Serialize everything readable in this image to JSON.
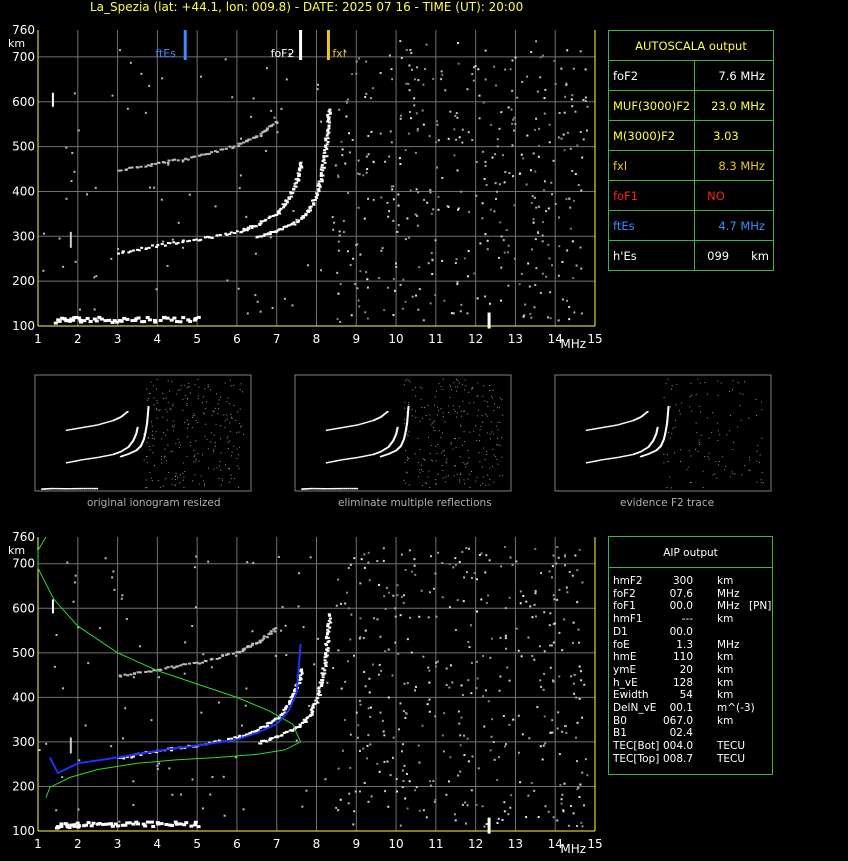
{
  "header": {
    "title": "La_Spezia (lat: +44.1, lon: 009.8) - DATE: 2025 07 16 - TIME (UT): 20:00"
  },
  "colors": {
    "axis": "#ffff40",
    "grid": "#707070",
    "border": "#3cb54a",
    "ftes": "#3c8cff",
    "fxl": "#e6c81e",
    "fof1": "#ff2020",
    "profile": "#30d830",
    "trace": "#2030ff"
  },
  "axes": {
    "x_ticks": [
      "1",
      "2",
      "3",
      "4",
      "5",
      "6",
      "7",
      "8",
      "9",
      "10",
      "11",
      "12",
      "13",
      "14",
      "15"
    ],
    "y_ticks": [
      "100",
      "200",
      "300",
      "400",
      "500",
      "600",
      "700",
      "760"
    ],
    "x_unit": "MHz",
    "y_unit": "km"
  },
  "markers": {
    "ftes_label": "ftEs",
    "fof2_label": "foF2",
    "fxl_label": "fxl"
  },
  "autoscala": {
    "title": "AUTOSCALA output",
    "rows": [
      {
        "label": "foF2",
        "value": "7.6 MHz"
      },
      {
        "label": "MUF(3000)F2",
        "value": "23.0 MHz"
      },
      {
        "label": "M(3000)F2",
        "value": "3.03"
      },
      {
        "label": "fxl",
        "value": "8.3 MHz"
      },
      {
        "label": "foF1",
        "value": "NO"
      },
      {
        "label": "ftEs",
        "value": "4.7 MHz"
      },
      {
        "label": "h'Es",
        "value": "099",
        "unit": "km"
      }
    ]
  },
  "thumbnails": {
    "captions": [
      "original ionogram resized",
      "eliminate multiple reflections",
      "evidence F2 trace"
    ]
  },
  "aip": {
    "title": "AIP output",
    "rows": [
      [
        "hmF2",
        "300",
        "km",
        ""
      ],
      [
        "foF2",
        "07.6",
        "MHz",
        ""
      ],
      [
        "foF1",
        "00.0",
        "MHz",
        "[PN]"
      ],
      [
        "hmF1",
        "---",
        "km",
        ""
      ],
      [
        "D1",
        "00.0",
        "",
        ""
      ],
      [
        "foE",
        "1.3",
        "MHz",
        ""
      ],
      [
        "hmE",
        "110",
        "km",
        ""
      ],
      [
        "ymE",
        "20",
        "km",
        ""
      ],
      [
        "h_vE",
        "128",
        "km",
        ""
      ],
      [
        "Ewidth",
        "54",
        "km",
        ""
      ],
      [
        "DelN_vE",
        "00.1",
        "m^(-3)",
        ""
      ],
      [
        "B0",
        "067.0",
        "km",
        ""
      ],
      [
        "B1",
        "02.4",
        "",
        ""
      ],
      [
        "TEC[Bot]",
        "004.0",
        "TECU",
        ""
      ],
      [
        "TEC[Top]",
        "008.7",
        "TECU",
        ""
      ]
    ]
  },
  "chart_data": [
    {
      "type": "scatter",
      "title": "",
      "xlabel": "MHz",
      "ylabel": "km",
      "xlim": [
        1,
        15
      ],
      "ylim": [
        100,
        760
      ],
      "grid": true,
      "markers": [
        {
          "name": "ftEs",
          "x": 4.7
        },
        {
          "name": "foF2",
          "x": 7.6
        },
        {
          "name": "fxl",
          "x": 8.3
        }
      ],
      "traces": [
        {
          "name": "E layer echo",
          "x": [
            1.4,
            2.0,
            3.0,
            4.0,
            5.1
          ],
          "y": [
            115,
            118,
            117,
            118,
            118
          ]
        },
        {
          "name": "F2 O-mode",
          "x": [
            3.0,
            4.0,
            5.0,
            6.0,
            6.5,
            7.0,
            7.3,
            7.5,
            7.6
          ],
          "y": [
            265,
            282,
            295,
            312,
            328,
            355,
            390,
            430,
            470
          ]
        },
        {
          "name": "F2 X-mode",
          "x": [
            6.5,
            7.0,
            7.5,
            7.8,
            8.0,
            8.1,
            8.2,
            8.25,
            8.3
          ],
          "y": [
            300,
            315,
            335,
            360,
            400,
            440,
            490,
            540,
            590
          ]
        },
        {
          "name": "F2 second hop",
          "x": [
            3.0,
            4.0,
            5.0,
            6.0,
            6.5,
            7.0
          ],
          "y": [
            450,
            465,
            480,
            505,
            525,
            560
          ]
        }
      ]
    },
    {
      "type": "line",
      "title": "",
      "xlabel": "MHz",
      "ylabel": "km",
      "xlim": [
        1,
        15
      ],
      "ylim": [
        100,
        760
      ],
      "grid": true,
      "series": [
        {
          "name": "profile",
          "x": [
            1.2,
            1.0,
            1.0,
            1.4,
            2.0,
            3.0,
            4.0,
            5.0,
            6.0,
            6.8,
            7.4,
            7.6,
            7.2,
            6.5,
            5.5,
            4.5,
            3.5,
            2.5,
            1.8,
            1.3,
            1.2
          ],
          "y": [
            760,
            730,
            690,
            620,
            560,
            500,
            460,
            430,
            400,
            370,
            340,
            300,
            282,
            272,
            265,
            260,
            252,
            238,
            220,
            198,
            175
          ]
        },
        {
          "name": "trace",
          "x": [
            1.3,
            1.5,
            2.0,
            3.0,
            4.0,
            5.0,
            6.0,
            6.5,
            7.0,
            7.3,
            7.5,
            7.6
          ],
          "y": [
            265,
            230,
            252,
            265,
            280,
            292,
            305,
            320,
            340,
            370,
            410,
            520
          ]
        }
      ]
    }
  ]
}
